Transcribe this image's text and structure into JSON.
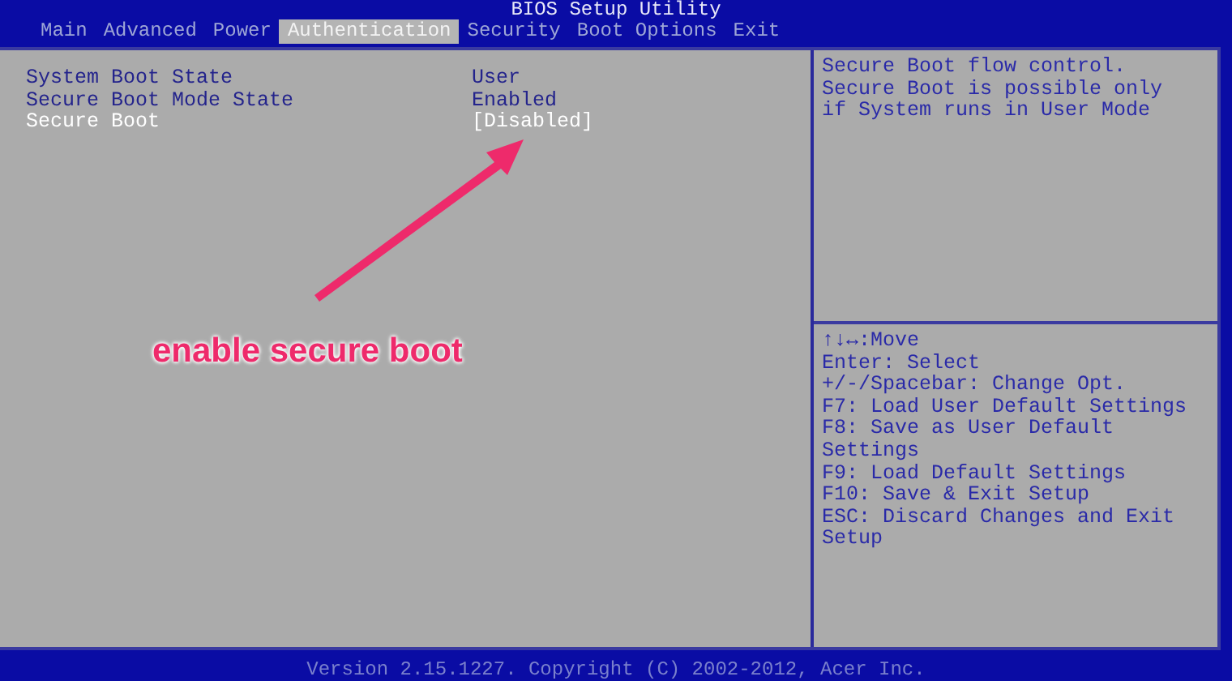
{
  "window": {
    "title": "BIOS Setup Utility"
  },
  "tabs": [
    {
      "label": "Main",
      "selected": false
    },
    {
      "label": "Advanced",
      "selected": false
    },
    {
      "label": "Power",
      "selected": false
    },
    {
      "label": "Authentication",
      "selected": true
    },
    {
      "label": "Security",
      "selected": false
    },
    {
      "label": "Boot Options",
      "selected": false
    },
    {
      "label": "Exit",
      "selected": false
    }
  ],
  "settings": [
    {
      "label": "System Boot State",
      "value": "User",
      "selected": false
    },
    {
      "label": "Secure Boot Mode State",
      "value": "Enabled",
      "selected": false
    },
    {
      "label": "Secure Boot",
      "value": "[Disabled]",
      "selected": true
    }
  ],
  "help": {
    "description": [
      "Secure Boot flow control.",
      "Secure Boot is possible only",
      "if System runs in User Mode"
    ],
    "keys": [
      "↑↓↔:Move",
      "Enter: Select",
      "+/-/Spacebar: Change Opt.",
      "F7: Load User Default Settings",
      "F8: Save as User Default Settings",
      "F9: Load Default Settings",
      "F10: Save & Exit Setup",
      "ESC: Discard Changes and Exit Setup"
    ]
  },
  "annotation": {
    "text": "enable secure boot"
  },
  "status_bar": "Version 2.15.1227. Copyright (C) 2002-2012, Acer Inc."
}
